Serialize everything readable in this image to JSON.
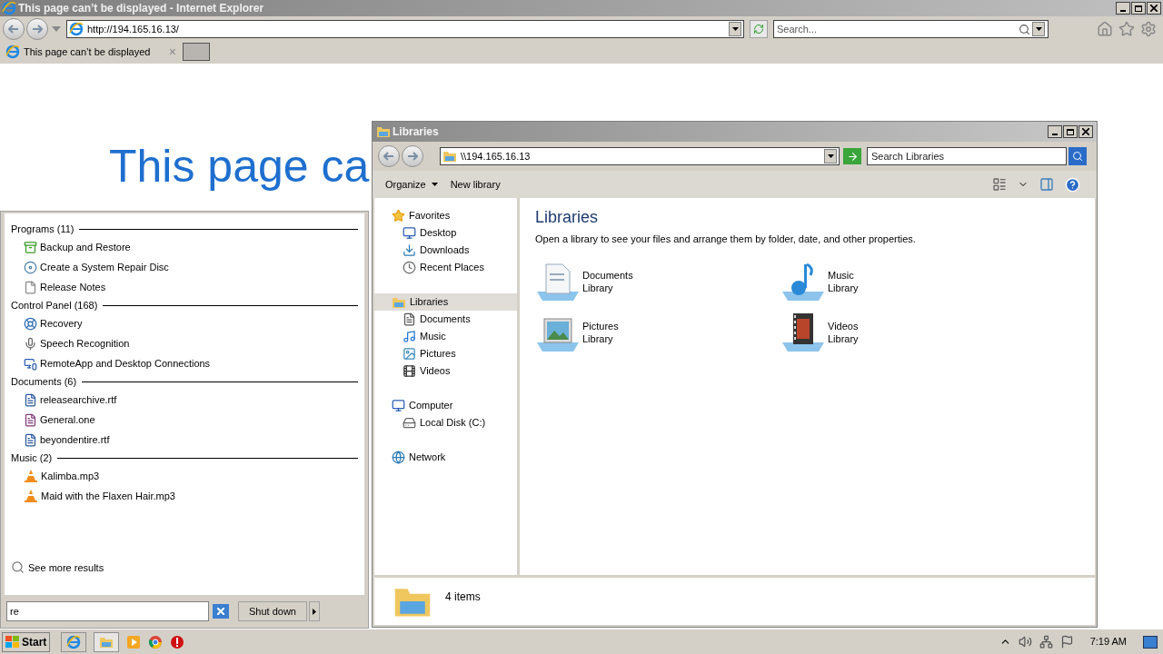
{
  "browser": {
    "title": "This page can’t be displayed - Internet Explorer",
    "url": "http://194.165.16.13/",
    "search_placeholder": "Search...",
    "tab": {
      "title": "This page can’t be displayed",
      "close": "×"
    },
    "page_heading": "This page ca"
  },
  "start_menu": {
    "groups": [
      {
        "label": "Programs (11)",
        "items": [
          "Backup and Restore",
          "Create a System Repair Disc",
          "Release Notes"
        ]
      },
      {
        "label": "Control Panel (168)",
        "items": [
          "Recovery",
          "Speech Recognition",
          "RemoteApp and Desktop Connections"
        ]
      },
      {
        "label": "Documents (6)",
        "items": [
          "releasearchive.rtf",
          "General.one",
          "beyondentire.rtf"
        ]
      },
      {
        "label": "Music (2)",
        "items": [
          "Kalimba.mp3",
          "Maid with the Flaxen Hair.mp3"
        ]
      }
    ],
    "see_more": "See more results",
    "search_value": "re",
    "shutdown": "Shut down"
  },
  "explorer": {
    "title": "Libraries",
    "address": "\\\\194.165.16.13",
    "search_placeholder": "Search Libraries",
    "toolbar": [
      "Organize",
      "New library"
    ],
    "nav": [
      {
        "label": "Favorites",
        "selected": false,
        "children": [
          {
            "label": "Desktop",
            "selected": false
          },
          {
            "label": "Downloads",
            "selected": false
          },
          {
            "label": "Recent Places",
            "selected": false
          }
        ]
      },
      {
        "label": "Libraries",
        "selected": true,
        "children": [
          {
            "label": "Documents",
            "selected": false
          },
          {
            "label": "Music",
            "selected": false
          },
          {
            "label": "Pictures",
            "selected": false
          },
          {
            "label": "Videos",
            "selected": false
          }
        ]
      },
      {
        "label": "Computer",
        "selected": false,
        "children": [
          {
            "label": "Local Disk (C:)",
            "selected": false
          }
        ]
      },
      {
        "label": "Network",
        "selected": false
      }
    ],
    "heading": "Libraries",
    "description": "Open a library to see your files and arrange them by folder, date, and other properties.",
    "libraries": [
      {
        "name": "Documents",
        "type": "Library"
      },
      {
        "name": "Music",
        "type": "Library"
      },
      {
        "name": "Pictures",
        "type": "Library"
      },
      {
        "name": "Videos",
        "type": "Library"
      }
    ],
    "status": "4 items"
  },
  "taskbar": {
    "start": "Start",
    "clock": "7:19 AM"
  }
}
